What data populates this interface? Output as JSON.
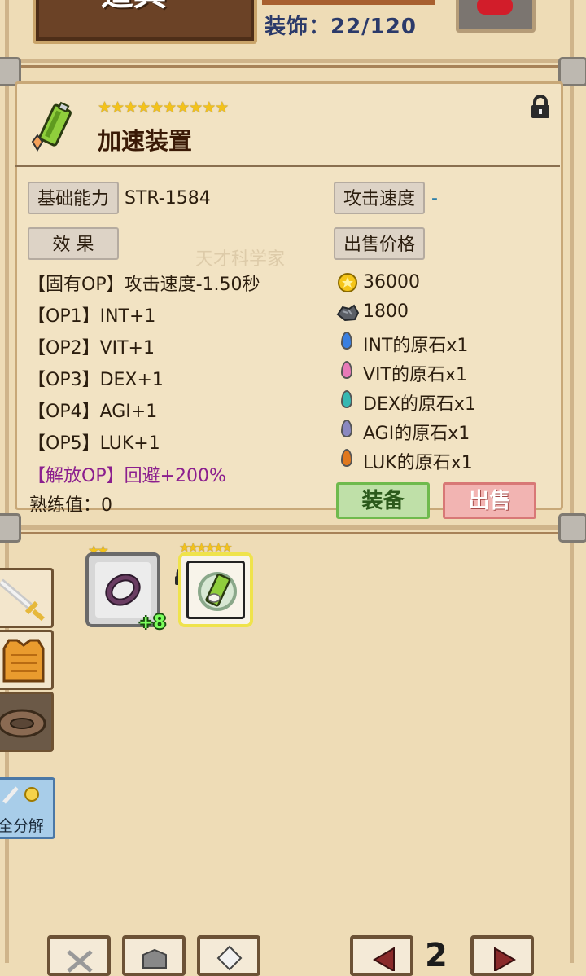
{
  "header": {
    "title": "道具",
    "deco_count": "装饰：22/120"
  },
  "item": {
    "stars": "★★★★★★★★★★",
    "name": "加速装置",
    "base_label": "基础能力",
    "base_value": "STR-1584",
    "attack_speed_label": "攻击速度",
    "attack_speed_value": "-",
    "effect_label": "效 果",
    "sell_price_label": "出售价格",
    "effects": [
      "【固有OP】攻击速度-1.50秒",
      "【OP1】INT+1",
      "【OP2】VIT+1",
      "【OP3】DEX+1",
      "【OP4】AGI+1",
      "【OP5】LUK+1"
    ],
    "release_op": "【解放OP】回避+200%",
    "proficiency": "熟练值：0",
    "prices": [
      {
        "icon": "gold-coin-icon",
        "text": "36000",
        "color": "#f5c518"
      },
      {
        "icon": "ore-icon",
        "text": "1800",
        "color": "#555555"
      },
      {
        "icon": "gem-icon",
        "text": "INT的原石x1",
        "color": "#3a7fe0"
      },
      {
        "icon": "gem-icon",
        "text": "VIT的原石x1",
        "color": "#e87ab8"
      },
      {
        "icon": "gem-icon",
        "text": "DEX的原石x1",
        "color": "#36b8b2"
      },
      {
        "icon": "gem-icon",
        "text": "AGI的原石x1",
        "color": "#8a88c0"
      },
      {
        "icon": "gem-icon",
        "text": "LUK的原石x1",
        "color": "#e0781e"
      }
    ],
    "equip_label": "装备",
    "sell_label": "出售"
  },
  "inventory": {
    "ring_stars": "★★",
    "ring_plus": "+8",
    "gear_stars": "★★★★★★★★★★"
  },
  "side": {
    "decompose_label": "全分解"
  },
  "pager": {
    "page": "2"
  }
}
